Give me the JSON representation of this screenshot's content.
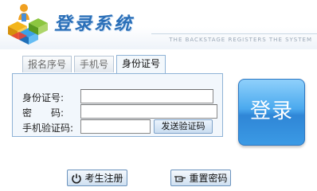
{
  "header": {
    "title": "登录系统",
    "subtitle": "THE BACKSTAGE REGISTERS THE SYSTEM"
  },
  "tabs": [
    {
      "label": "报名序号",
      "active": false
    },
    {
      "label": "手机号",
      "active": false
    },
    {
      "label": "身份证号",
      "active": true
    }
  ],
  "form": {
    "id_label": "身份证号:",
    "id_value": "",
    "password_label": "密　　码:",
    "password_value": "",
    "sms_label": "手机验证码:",
    "sms_value": "",
    "send_sms_label": "发送验证码"
  },
  "login_button": {
    "label": "登录",
    "color": "#3b9ae5"
  },
  "bottom": {
    "register_label": "考生注册",
    "register_icon": "power-icon",
    "reset_label": "重置密码",
    "reset_icon": "hand-point-icon"
  }
}
